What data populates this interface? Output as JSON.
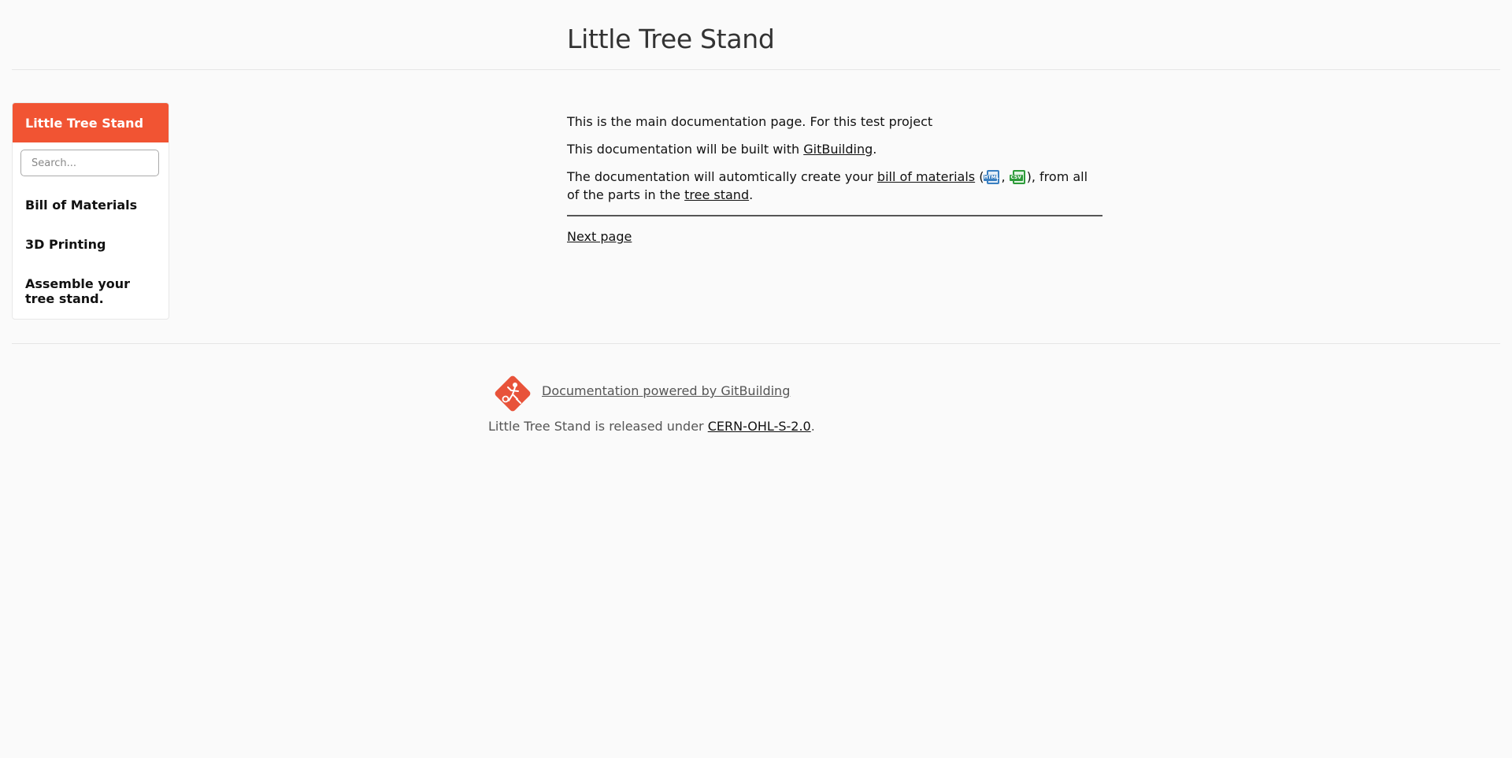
{
  "header": {
    "title": "Little Tree Stand"
  },
  "sidebar": {
    "title": "Little Tree Stand",
    "search_placeholder": "Search...",
    "items": [
      {
        "label": "Bill of Materials"
      },
      {
        "label": "3D Printing"
      },
      {
        "label": "Assemble your tree stand."
      }
    ]
  },
  "main": {
    "p1": "This is the main documentation page. For this test project",
    "p2_prefix": "This documentation will be built with ",
    "p2_link": "GitBuilding",
    "p2_suffix": ".",
    "p3_prefix": "The documentation will automtically create your ",
    "p3_bom_link": "bill of materials",
    "p3_open_paren": " (",
    "p3_comma": ", ",
    "p3_after_icons": "), from all of the parts in the ",
    "p3_tree_link": "tree stand",
    "p3_suffix": ".",
    "html_icon_label": "HTML",
    "csv_icon_label": "CSV",
    "next_page": "Next page"
  },
  "footer": {
    "powered_by": "Documentation powered by GitBuilding",
    "license_prefix": "Little Tree Stand is released under ",
    "license_link": "CERN-OHL-S-2.0",
    "license_suffix": "."
  },
  "colors": {
    "accent": "#f15433",
    "html_icon": "#3a7fc1",
    "csv_icon": "#2e9b3a"
  }
}
